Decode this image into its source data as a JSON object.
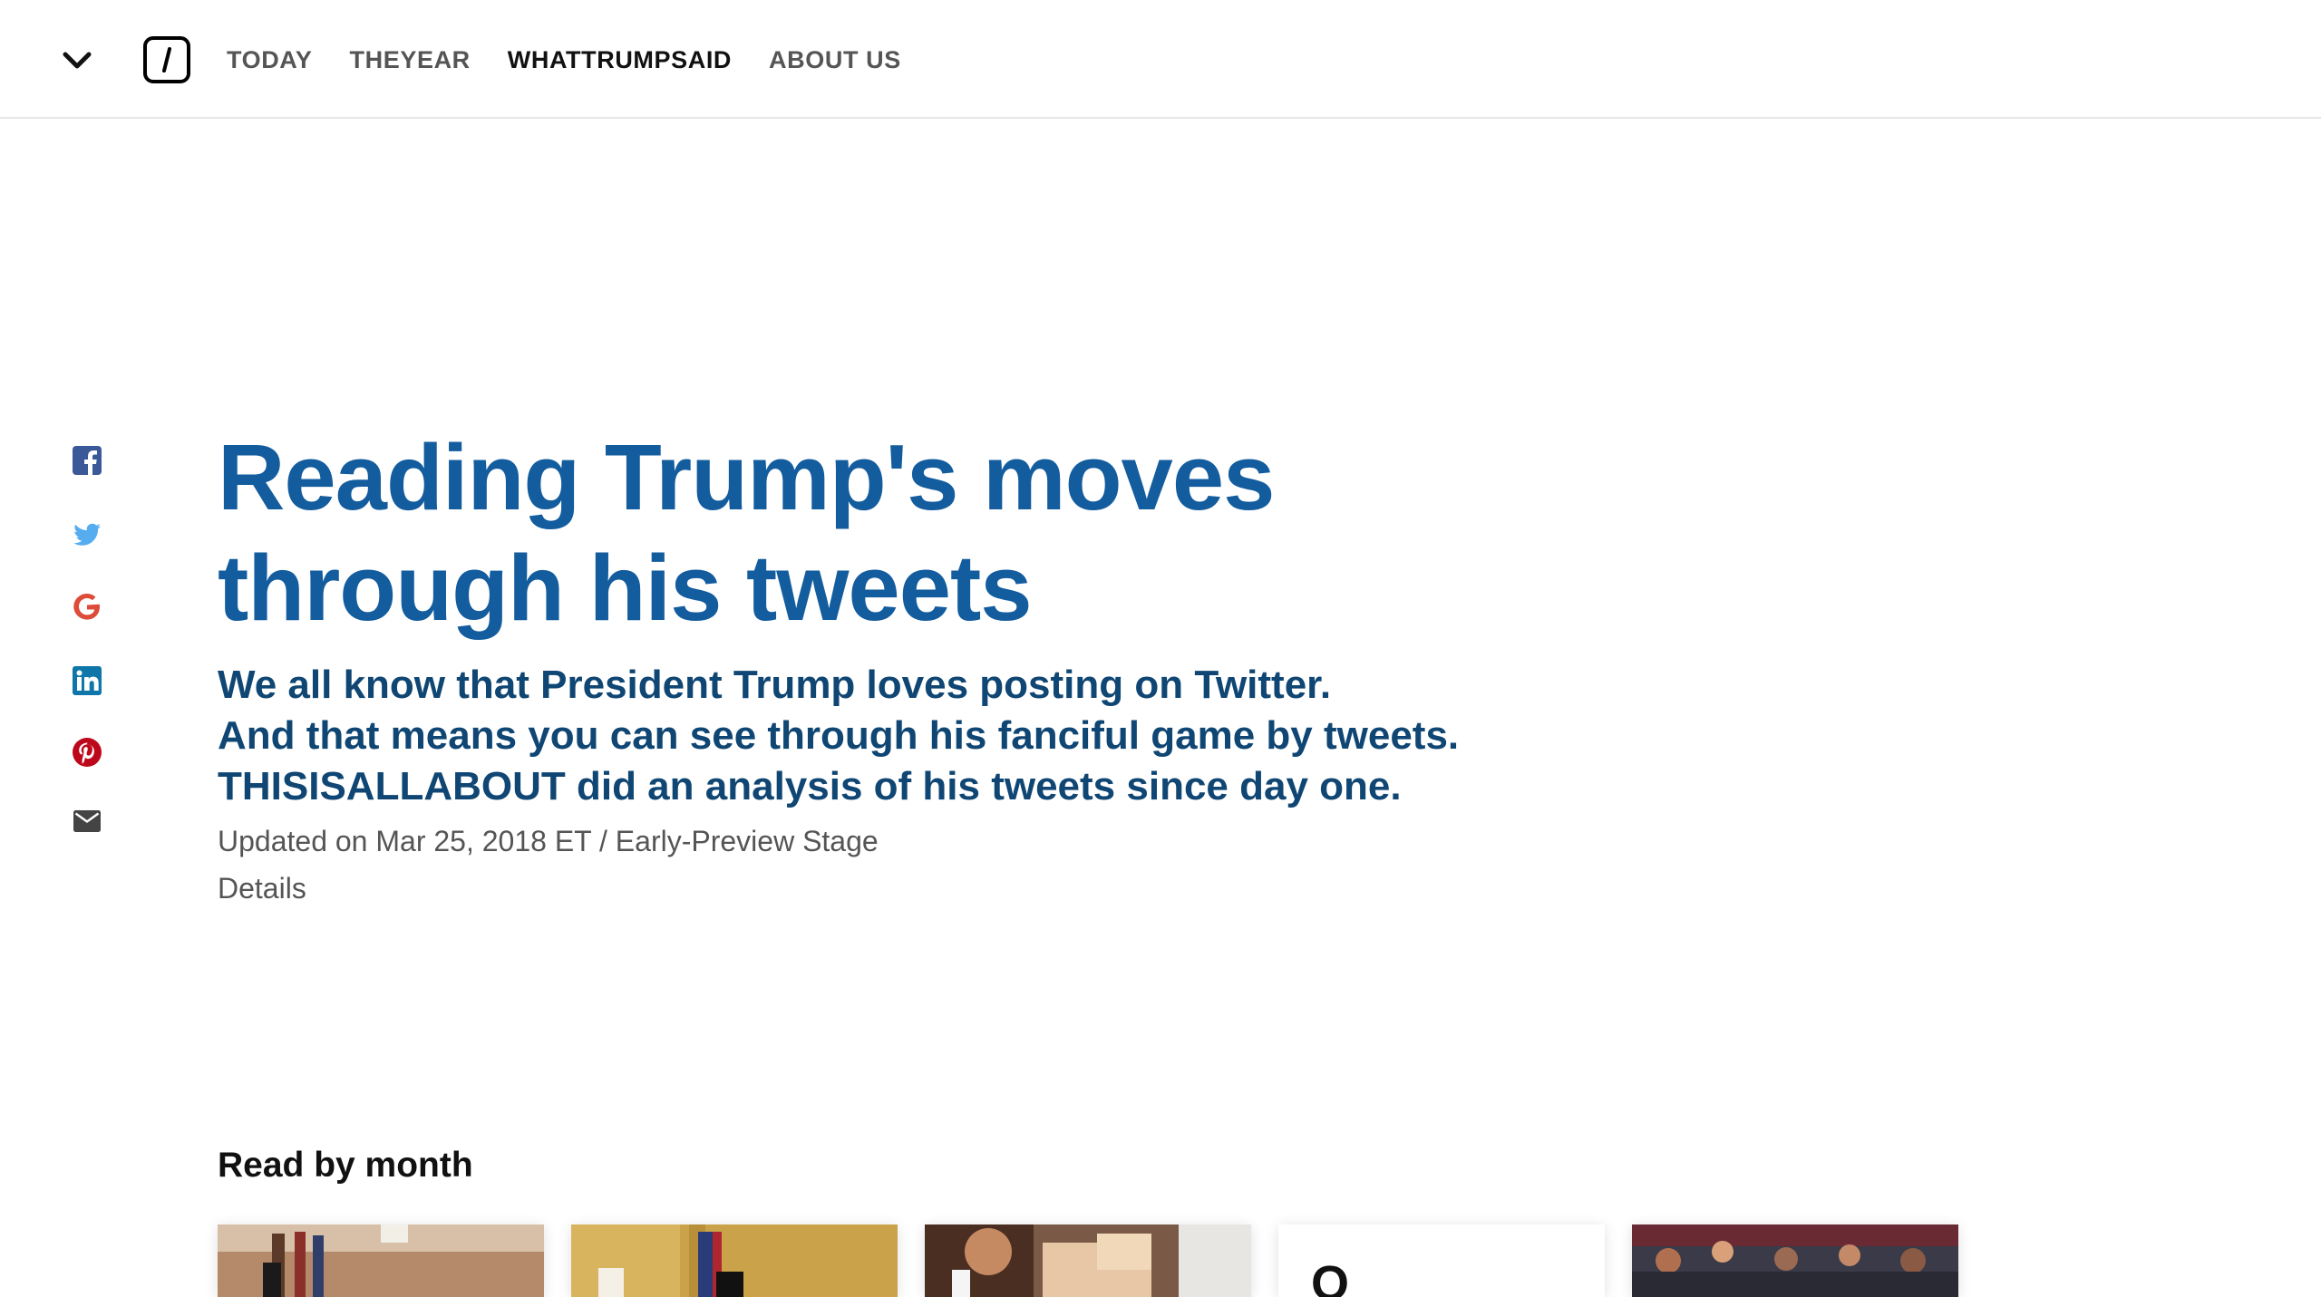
{
  "nav": {
    "menu_icon": "chevron-down-icon",
    "logo_icon": "slash-logo-icon",
    "items": [
      {
        "label": "TODAY",
        "active": false
      },
      {
        "label": "THEYEAR",
        "active": false
      },
      {
        "label": "WHATTRUMPSAID",
        "active": true
      },
      {
        "label": "ABOUT US",
        "active": false
      }
    ]
  },
  "share": [
    {
      "name": "facebook-icon",
      "color": "#3b5998"
    },
    {
      "name": "twitter-icon",
      "color": "#55acee"
    },
    {
      "name": "google-icon",
      "color": "#dd4b39"
    },
    {
      "name": "linkedin-icon",
      "color": "#0e76a8"
    },
    {
      "name": "pinterest-icon",
      "color": "#bd081c"
    },
    {
      "name": "email-icon",
      "color": "#444444"
    }
  ],
  "hero": {
    "title": "Reading Trump's moves through his tweets",
    "subtitle_lines": [
      "We all know that President Trump loves posting on Twitter.",
      "And that means you can see through his fanciful game by tweets.",
      "THISISALLABOUT did an analysis of his tweets since day one."
    ],
    "updated": "Updated on Mar 25, 2018 ET / Early-Preview Stage",
    "details": "Details"
  },
  "months": {
    "title": "Read by month",
    "cards": [
      {
        "kind": "photo",
        "tone": "room"
      },
      {
        "kind": "photo",
        "tone": "oval"
      },
      {
        "kind": "photo",
        "tone": "crowd"
      },
      {
        "kind": "text",
        "caption": "O"
      },
      {
        "kind": "photo",
        "tone": "rally"
      }
    ]
  },
  "colors": {
    "title": "#135c9e",
    "subtitle": "#0f4673",
    "meta": "#555555"
  }
}
